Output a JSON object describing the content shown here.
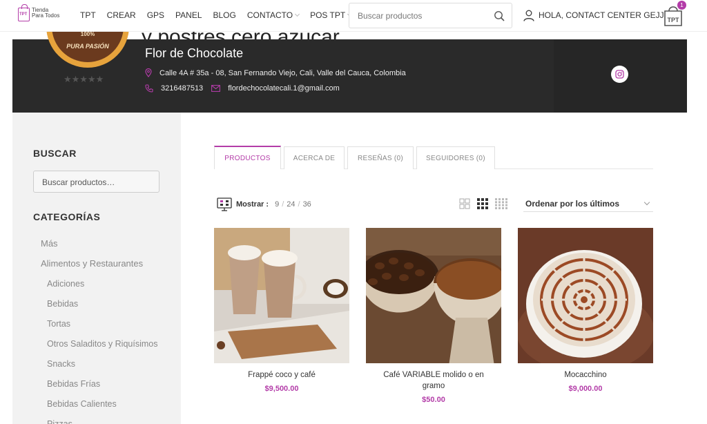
{
  "header": {
    "logo": {
      "line1": "Tienda",
      "line2": "Para Todos",
      "badge": "TPT"
    },
    "nav": [
      {
        "label": "TPT",
        "dropdown": false
      },
      {
        "label": "CREAR",
        "dropdown": false
      },
      {
        "label": "GPS",
        "dropdown": false
      },
      {
        "label": "PANEL",
        "dropdown": false
      },
      {
        "label": "BLOG",
        "dropdown": false
      },
      {
        "label": "CONTACTO",
        "dropdown": true
      },
      {
        "label": "POS TPT",
        "dropdown": true
      }
    ],
    "search_placeholder": "Buscar productos",
    "account_label": "HOLA, CONTACT CENTER GEJJ",
    "cart": {
      "label": "TPT",
      "count": "1"
    },
    "accent_color": "#b33ca8"
  },
  "store": {
    "background_text": "y postres cero azúcar",
    "avatar_text": "PURA PASIÓN",
    "avatar_pct": "100%",
    "rating_stars": "★★★★★",
    "name": "Flor de Chocolate",
    "address": "Calle 4A # 35a - 08, San Fernando Viejo, Cali, Valle del Cauca, Colombia",
    "phone": "3216487513",
    "email": "flordechocolatecali.1@gmail.com"
  },
  "sidebar": {
    "search_heading": "BUSCAR",
    "search_placeholder": "Buscar productos…",
    "categories_heading": "CATEGORÍAS",
    "categories": [
      {
        "label": "Más",
        "level": 1
      },
      {
        "label": "Alimentos y Restaurantes",
        "level": 1
      },
      {
        "label": "Adiciones",
        "level": 2
      },
      {
        "label": "Bebidas",
        "level": 2
      },
      {
        "label": "Tortas",
        "level": 2
      },
      {
        "label": "Otros Saladitos y Riquísimos",
        "level": 2
      },
      {
        "label": "Snacks",
        "level": 2
      },
      {
        "label": "Bebidas Frías",
        "level": 2
      },
      {
        "label": "Bebidas Calientes",
        "level": 2
      },
      {
        "label": "Pizzas",
        "level": 2
      }
    ]
  },
  "tabs": [
    {
      "label": "PRODUCTOS",
      "active": true
    },
    {
      "label": "ACERCA DE",
      "active": false
    },
    {
      "label": "RESEÑAS (0)",
      "active": false
    },
    {
      "label": "SEGUIDORES (0)",
      "active": false
    }
  ],
  "toolbar": {
    "show_label": "Mostrar :",
    "counts": [
      "9",
      "24",
      "36"
    ],
    "sort_label": "Ordenar por los últimos"
  },
  "products": [
    {
      "title": "Frappé coco y café",
      "price": "$9,500.00",
      "image": "frappe-glasses-photo"
    },
    {
      "title": "Café VARIABLE molido o en gramo",
      "price": "$50.00",
      "image": "coffee-beans-bowls-photo"
    },
    {
      "title": "Mocacchino",
      "price": "$9,000.00",
      "image": "latte-art-cup-photo"
    }
  ]
}
